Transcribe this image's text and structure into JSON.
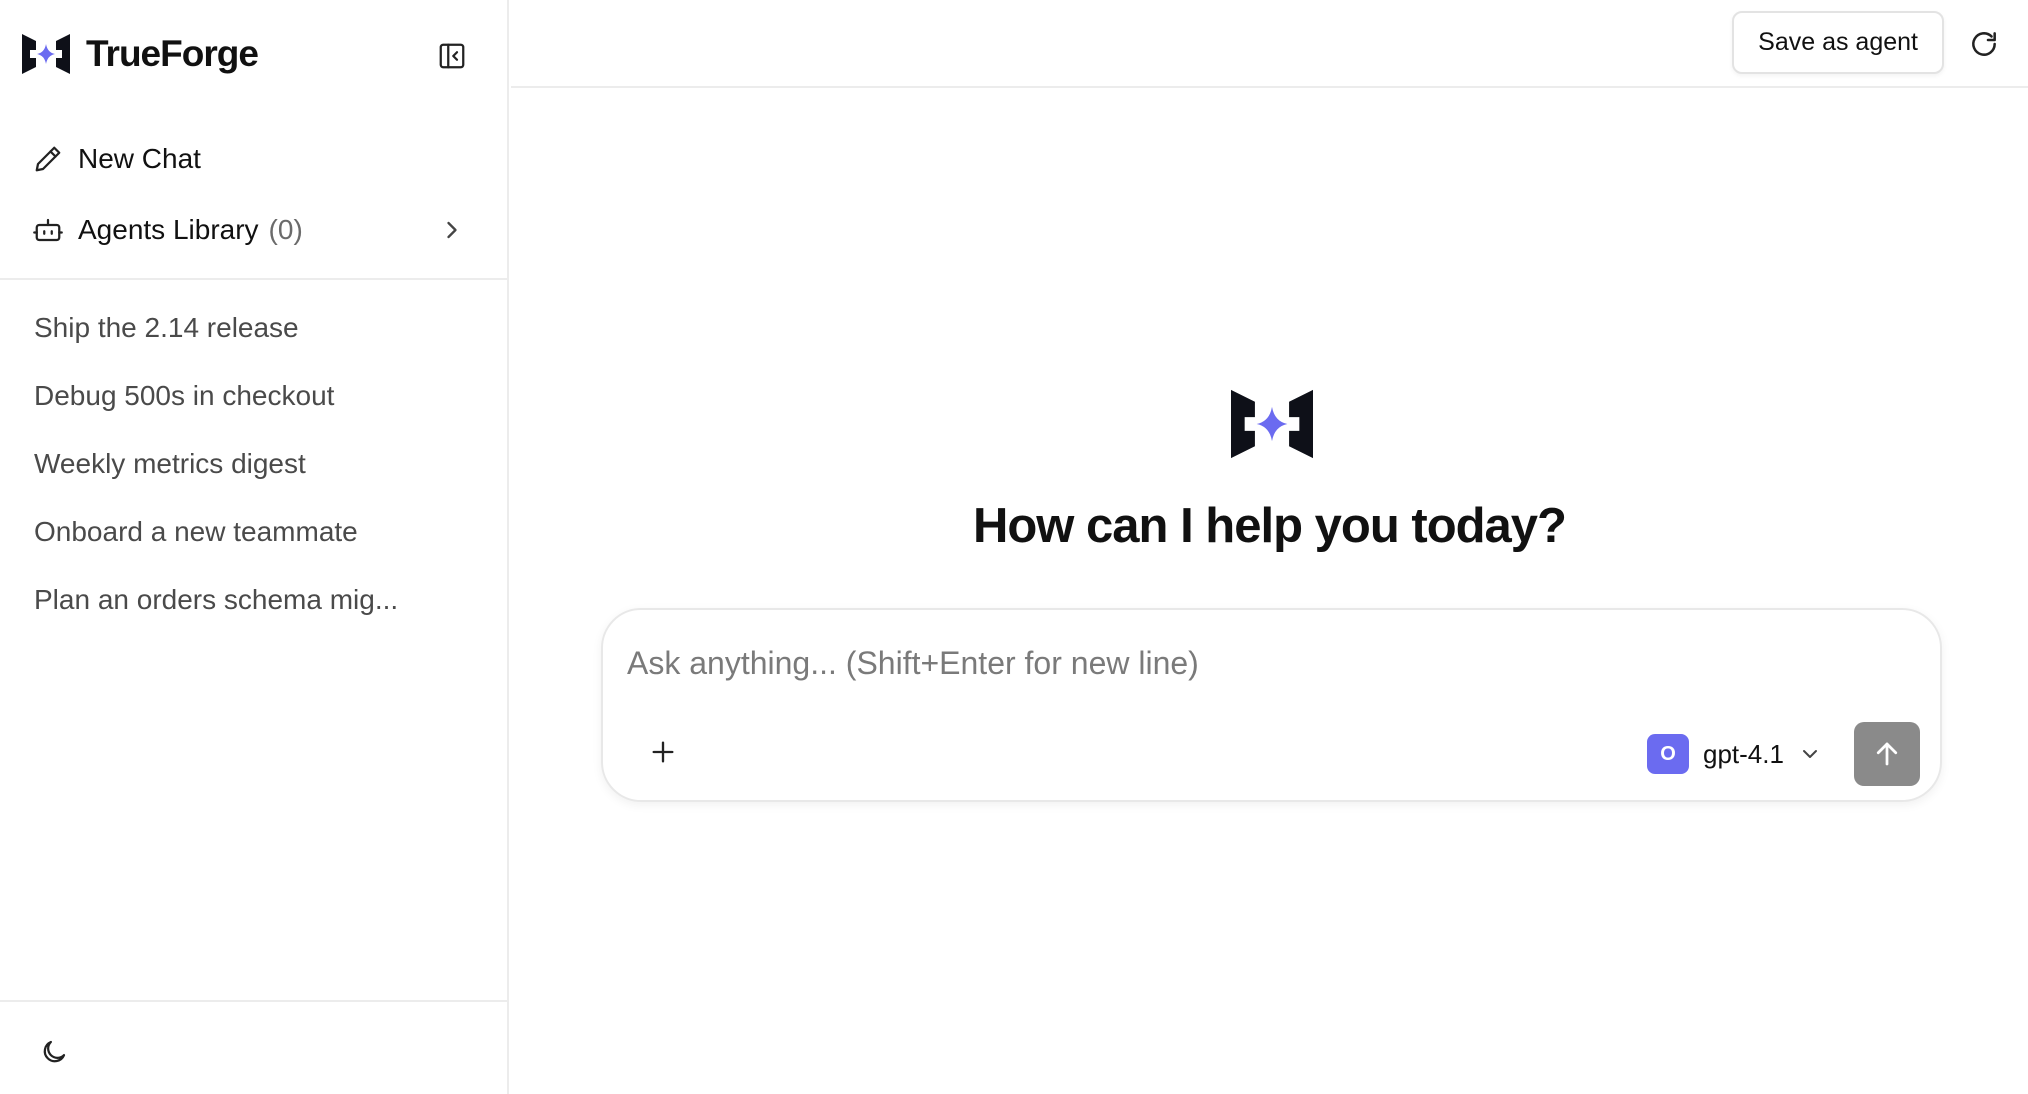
{
  "app": {
    "name": "TrueForge"
  },
  "sidebar": {
    "new_chat_label": "New Chat",
    "agents_label": "Agents Library",
    "agents_count": "(0)",
    "history": [
      "Ship the 2.14 release",
      "Debug 500s in checkout",
      "Weekly metrics digest",
      "Onboard a new teammate",
      "Plan an orders schema mig..."
    ]
  },
  "topbar": {
    "save_agent_label": "Save as agent"
  },
  "main": {
    "heading": "How can I help you today?",
    "composer": {
      "placeholder": "Ask anything... (Shift+Enter for new line)",
      "value": "",
      "model_badge": "O",
      "model_name": "gpt-4.1"
    }
  },
  "colors": {
    "accent": "#6b6bf0",
    "logo_dark": "#0e1018",
    "send_button": "#8a8a8a",
    "divider": "#ececec"
  },
  "icons": {
    "brand": "trueforge-logo-icon",
    "collapse": "sidebar-collapse-icon",
    "new_chat": "pencil-icon",
    "agents": "robot-icon",
    "agents_chevron": "chevron-right-icon",
    "theme": "moon-icon",
    "refresh": "refresh-icon",
    "attach": "plus-icon",
    "model_chevron": "chevron-down-icon",
    "send": "arrow-up-icon"
  }
}
